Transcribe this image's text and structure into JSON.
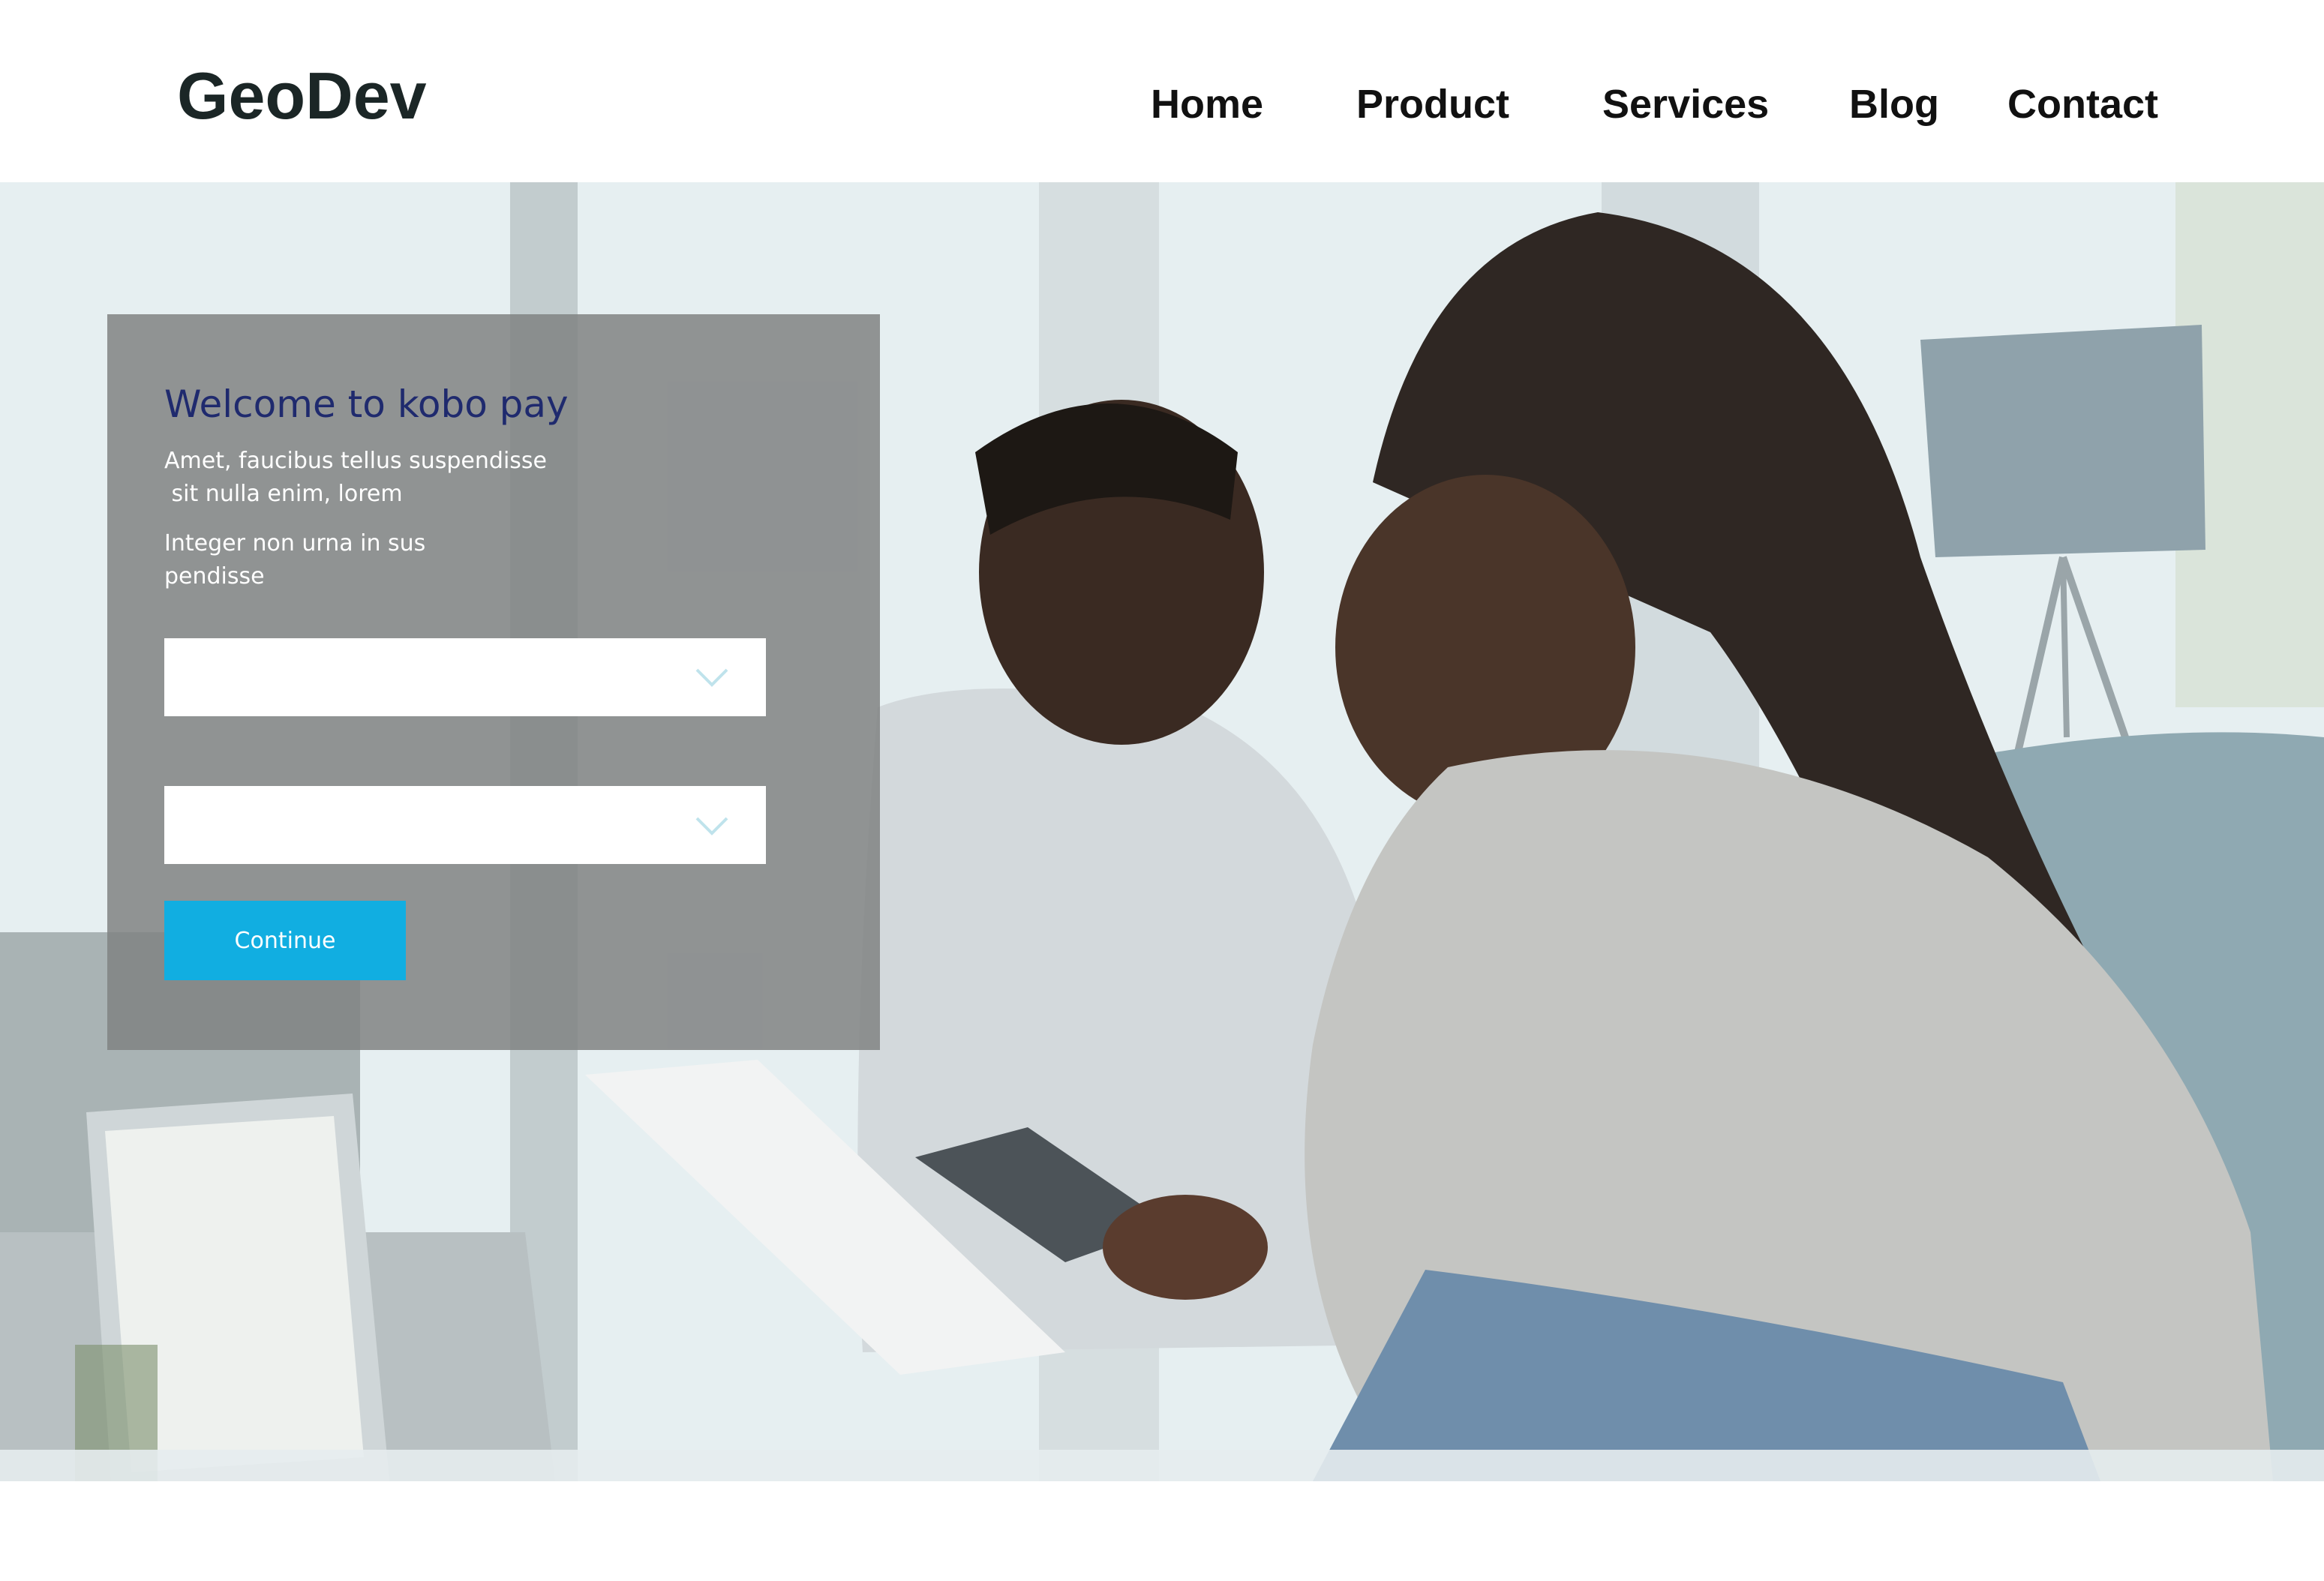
{
  "header": {
    "logo": "GeoDev",
    "nav": [
      {
        "label": "Home"
      },
      {
        "label": "Product"
      },
      {
        "label": "Services"
      },
      {
        "label": "Blog"
      },
      {
        "label": "Contact"
      }
    ]
  },
  "hero": {
    "image_alt_semantic": "couple-reviewing-finances-photo"
  },
  "form": {
    "title": "Welcome to kobo pay",
    "description_lines": [
      "Amet, faucibus tellus suspendisse",
      " sit nulla enim, lorem"
    ],
    "note_lines": [
      "Integer non urna in sus",
      "pendisse"
    ],
    "select_1_value": "",
    "select_2_value": "",
    "continue_label": "Continue"
  },
  "colors": {
    "title": "#1f2a6e",
    "button": "#11aee1",
    "panel": "#808282",
    "logo": "#1b2626"
  }
}
